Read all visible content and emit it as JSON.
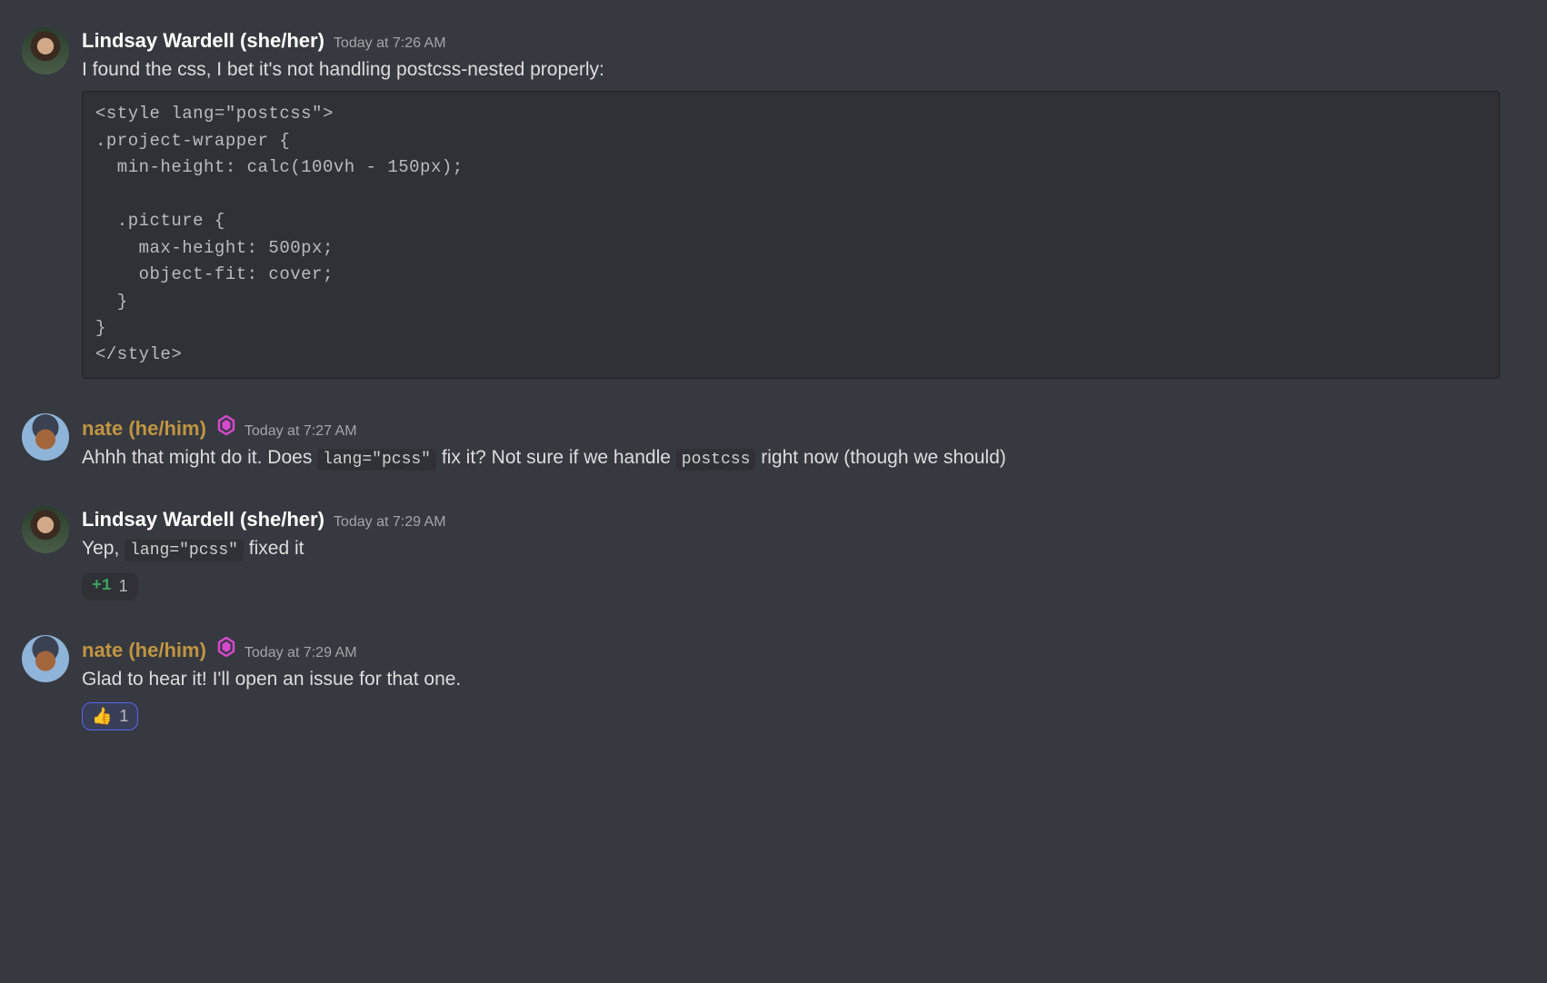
{
  "messages": {
    "m1": {
      "username": "Lindsay Wardell (she/her)",
      "timestamp": "Today at 7:26 AM",
      "text": "I found the css, I bet it's not handling postcss-nested properly:",
      "code": "<style lang=\"postcss\">\n.project-wrapper {\n  min-height: calc(100vh - 150px);\n\n  .picture {\n    max-height: 500px;\n    object-fit: cover;\n  }\n}\n</style>"
    },
    "m2": {
      "username": "nate (he/him)",
      "timestamp": "Today at 7:27 AM",
      "text_a": "Ahhh that might do it. Does ",
      "code_a": "lang=\"pcss\"",
      "text_b": " fix it? Not sure if we handle ",
      "code_b": "postcss",
      "text_c": " right now (though we should)"
    },
    "m3": {
      "username": "Lindsay Wardell (she/her)",
      "timestamp": "Today at 7:29 AM",
      "text_a": "Yep, ",
      "code_a": "lang=\"pcss\"",
      "text_b": " fixed it",
      "reaction_emoji": "+1",
      "reaction_count": "1"
    },
    "m4": {
      "username": "nate (he/him)",
      "timestamp": "Today at 7:29 AM",
      "text": "Glad to hear it! I'll open an issue for that one.",
      "reaction_emoji": "👍",
      "reaction_count": "1"
    }
  },
  "icons": {
    "nitro_badge": "nitro-badge-icon"
  }
}
